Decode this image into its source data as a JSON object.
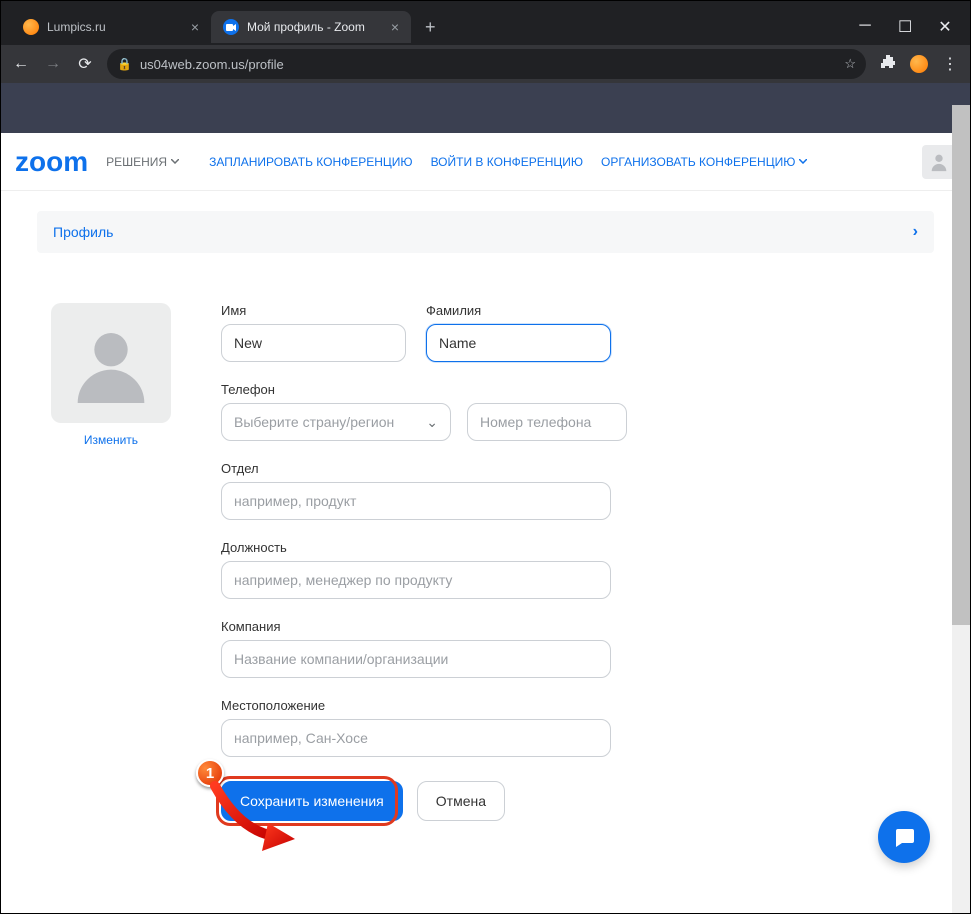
{
  "browser": {
    "tabs": [
      {
        "title": "Lumpics.ru"
      },
      {
        "title": "Мой профиль - Zoom"
      }
    ],
    "url": "us04web.zoom.us/profile"
  },
  "nav": {
    "logo": "zoom",
    "solutions": "РЕШЕНИЯ",
    "links": {
      "schedule": "ЗАПЛАНИРОВАТЬ КОНФЕРЕНЦИЮ",
      "join": "ВОЙТИ В КОНФЕРЕНЦИЮ",
      "host": "ОРГАНИЗОВАТЬ КОНФЕРЕНЦИЮ"
    }
  },
  "breadcrumb": {
    "label": "Профиль"
  },
  "avatar": {
    "change": "Изменить"
  },
  "form": {
    "first_name": {
      "label": "Имя",
      "value": "New"
    },
    "last_name": {
      "label": "Фамилия",
      "value": "Name"
    },
    "phone": {
      "label": "Телефон",
      "country_placeholder": "Выберите страну/регион",
      "number_placeholder": "Номер телефона"
    },
    "department": {
      "label": "Отдел",
      "placeholder": "например, продукт"
    },
    "job": {
      "label": "Должность",
      "placeholder": "например, менеджер по продукту"
    },
    "company": {
      "label": "Компания",
      "placeholder": "Название компании/организации"
    },
    "location": {
      "label": "Местоположение",
      "placeholder": "например, Сан-Хосе"
    },
    "save": "Сохранить изменения",
    "cancel": "Отмена"
  },
  "marker": {
    "num": "1"
  }
}
